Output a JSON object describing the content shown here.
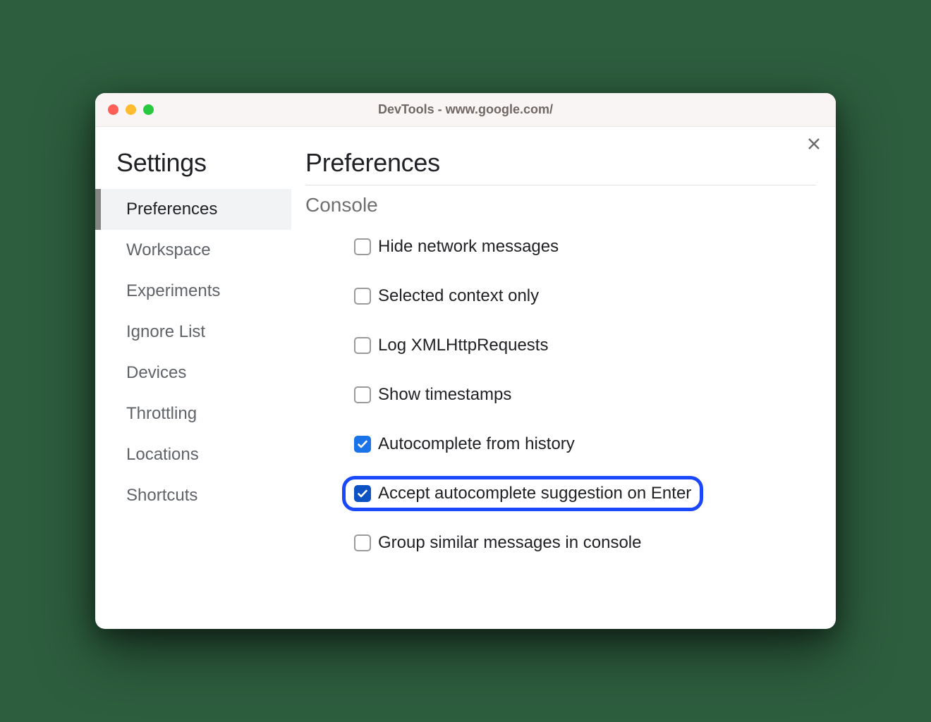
{
  "window": {
    "title": "DevTools - www.google.com/"
  },
  "sidebar": {
    "title": "Settings",
    "items": [
      {
        "label": "Preferences",
        "active": true
      },
      {
        "label": "Workspace",
        "active": false
      },
      {
        "label": "Experiments",
        "active": false
      },
      {
        "label": "Ignore List",
        "active": false
      },
      {
        "label": "Devices",
        "active": false
      },
      {
        "label": "Throttling",
        "active": false
      },
      {
        "label": "Locations",
        "active": false
      },
      {
        "label": "Shortcuts",
        "active": false
      }
    ]
  },
  "main": {
    "title": "Preferences",
    "section_title": "Console",
    "options": [
      {
        "label": "Hide network messages",
        "checked": false,
        "highlighted": false
      },
      {
        "label": "Selected context only",
        "checked": false,
        "highlighted": false
      },
      {
        "label": "Log XMLHttpRequests",
        "checked": false,
        "highlighted": false
      },
      {
        "label": "Show timestamps",
        "checked": false,
        "highlighted": false
      },
      {
        "label": "Autocomplete from history",
        "checked": true,
        "highlighted": false
      },
      {
        "label": "Accept autocomplete suggestion on Enter",
        "checked": true,
        "highlighted": true
      },
      {
        "label": "Group similar messages in console",
        "checked": false,
        "highlighted": false
      }
    ]
  }
}
